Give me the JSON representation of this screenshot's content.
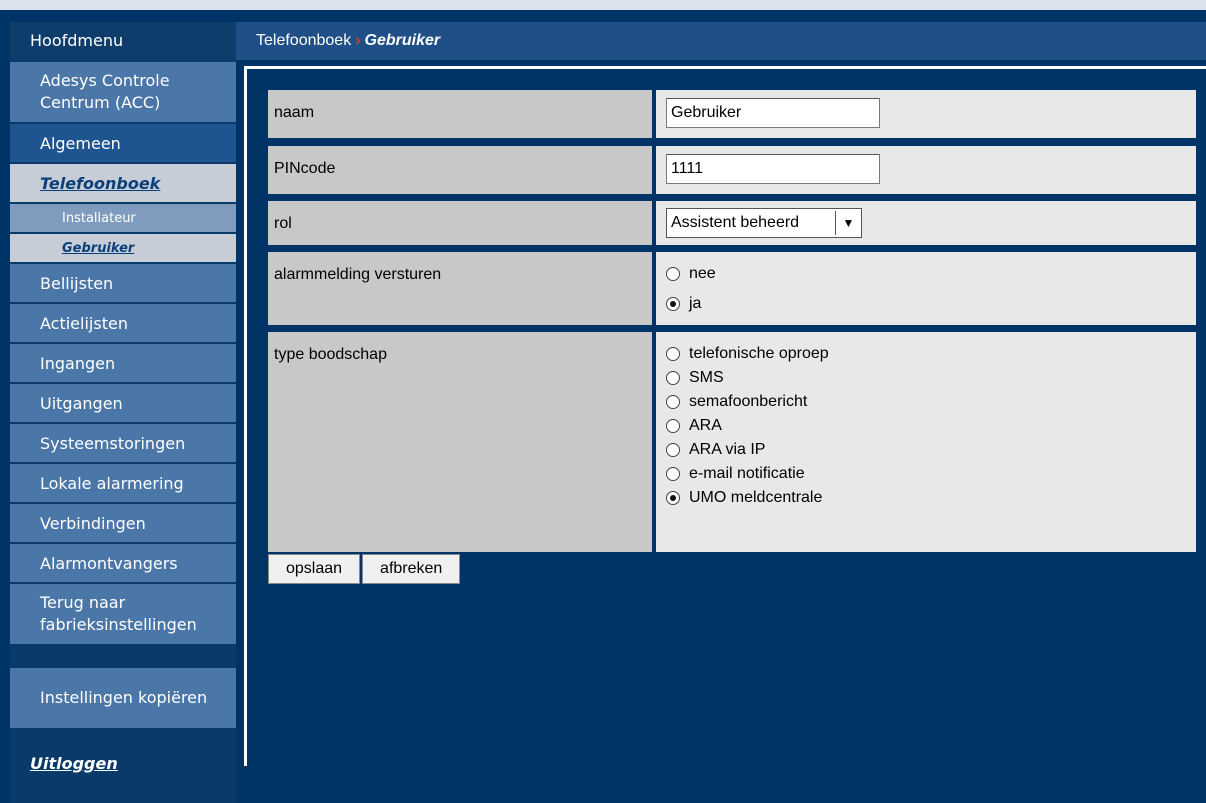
{
  "sidebar": {
    "title": "Hoofdmenu",
    "items": [
      "Adesys Controle Centrum (ACC)",
      "Algemeen",
      "Telefoonboek",
      "Installateur",
      "Gebruiker",
      "Bellijsten",
      "Actielijsten",
      "Ingangen",
      "Uitgangen",
      "Systeemstoringen",
      "Lokale alarmering",
      "Verbindingen",
      "Alarmontvangers",
      "Terug naar fabrieksinstellingen",
      "Instellingen kopiëren"
    ],
    "logout": "Uitloggen"
  },
  "header": {
    "parent": "Telefoonboek",
    "separator": "›",
    "current": "Gebruiker"
  },
  "form": {
    "naam": {
      "label": "naam",
      "value": "Gebruiker"
    },
    "pincode": {
      "label": "PINcode",
      "value": "1111"
    },
    "rol": {
      "label": "rol",
      "value": "Assistent beheerd"
    },
    "alarm": {
      "label": "alarmmelding versturen",
      "options": [
        "nee",
        "ja"
      ],
      "selected": "ja"
    },
    "type": {
      "label": "type boodschap",
      "options": [
        "telefonische oproep",
        "SMS",
        "semafoonbericht",
        "ARA",
        "ARA via IP",
        "e-mail notificatie",
        "UMO meldcentrale"
      ],
      "selected": "UMO meldcentrale"
    }
  },
  "buttons": {
    "save": "opslaan",
    "cancel": "afbreken"
  }
}
